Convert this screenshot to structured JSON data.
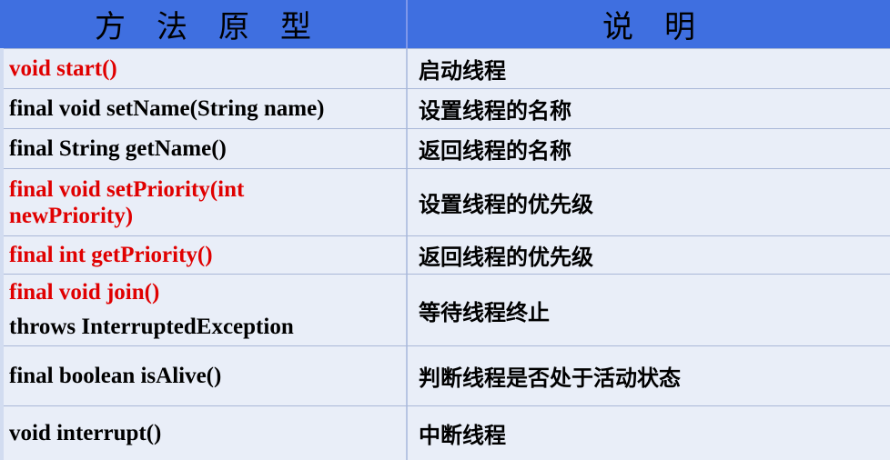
{
  "header": {
    "col1": "方法原型",
    "col2": "说明"
  },
  "rows": [
    {
      "method": "void start()",
      "desc": "启动线程"
    },
    {
      "method": "final void setName(String name)",
      "desc": "设置线程的名称"
    },
    {
      "method": "final String getName()",
      "desc": "返回线程的名称"
    },
    {
      "method_line1": "final void setPriority(int",
      "method_line2": "newPriority)",
      "desc": "设置线程的优先级"
    },
    {
      "method": "final int getPriority()",
      "desc": "返回线程的优先级"
    },
    {
      "method_line1": "final void join()",
      "method_line2": "throws InterruptedException",
      "desc": "等待线程终止"
    },
    {
      "method": "final boolean isAlive()",
      "desc": "判断线程是否处于活动状态"
    },
    {
      "method": "void interrupt()",
      "desc": "中断线程"
    }
  ],
  "colors": {
    "header_bg": "#3f6fe0",
    "row_bg": "#e9eef8",
    "highlight": "#e00000"
  }
}
